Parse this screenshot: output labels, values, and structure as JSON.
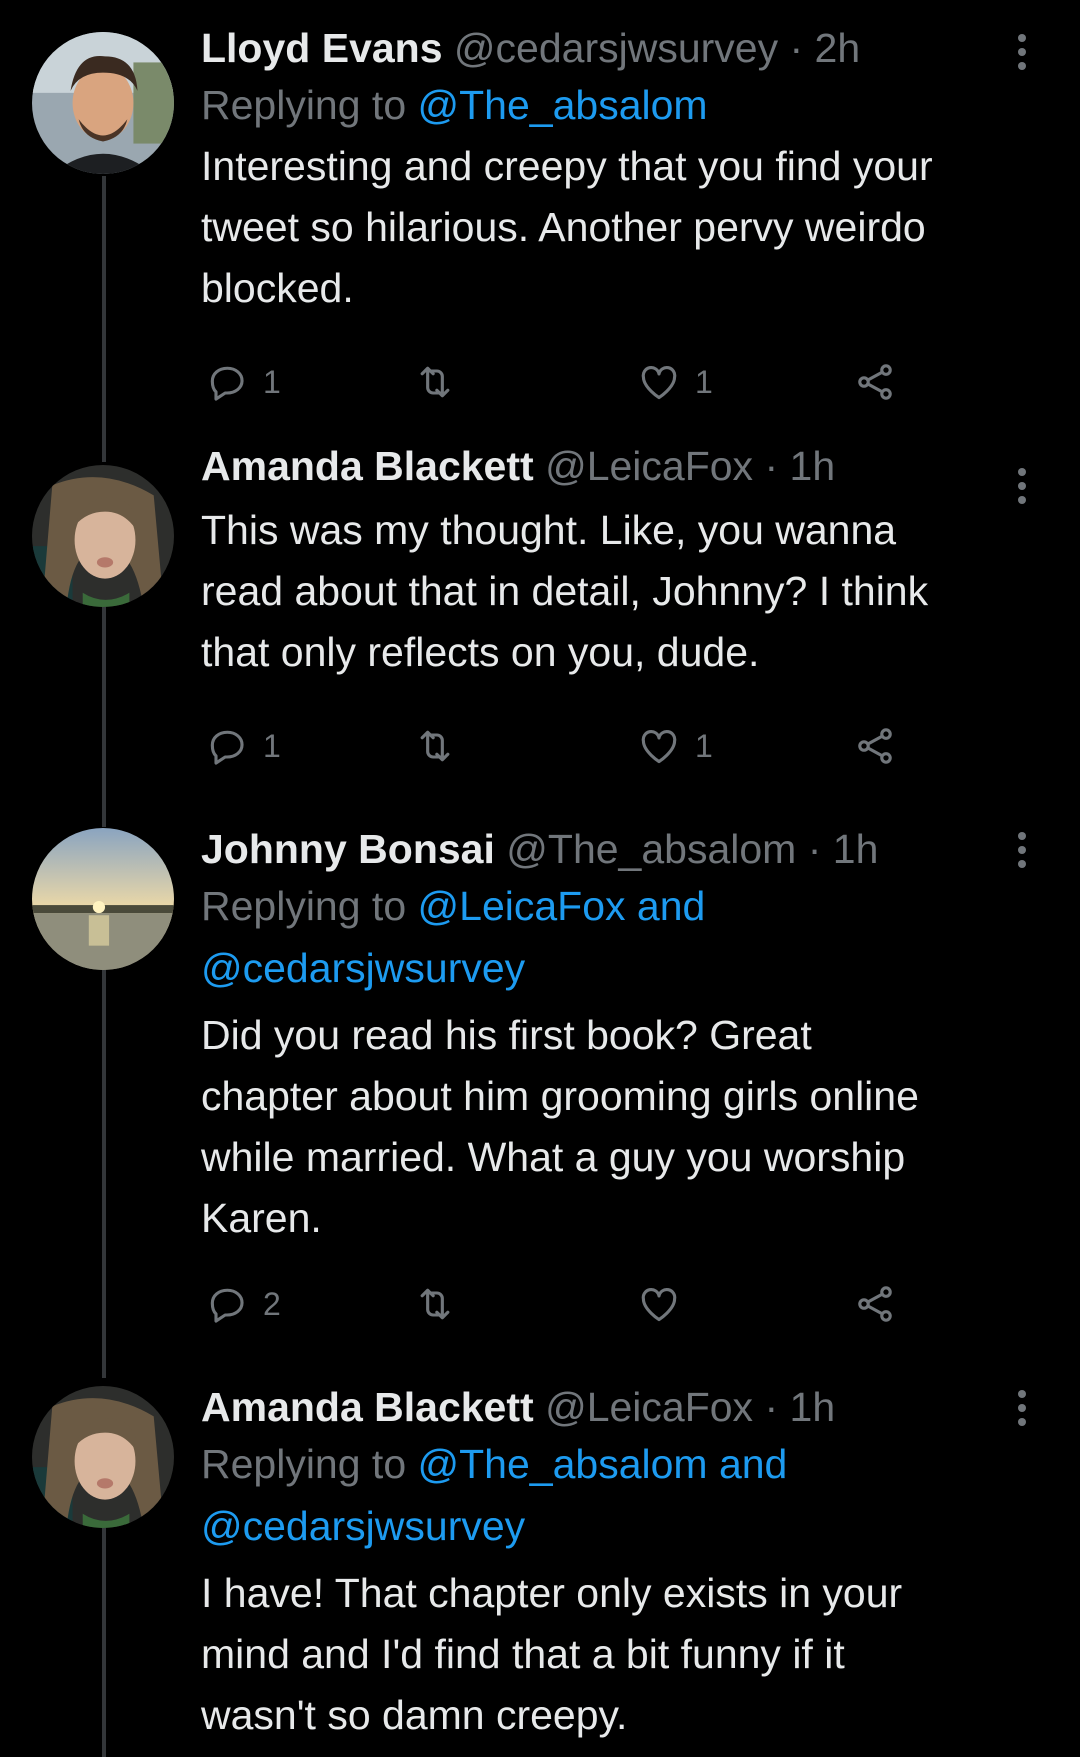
{
  "tweets": [
    {
      "name": "Lloyd Evans",
      "handle": "@cedarsjwsurvey",
      "time": "· 2h",
      "reply_prefix": "Replying to ",
      "reply_to_line1": "@The_absalom",
      "reply_to_line2": "",
      "text_lines": [
        "Interesting and creepy that you find your",
        "tweet so hilarious. Another pervy weirdo",
        "blocked."
      ],
      "reply_count": "1",
      "like_count": "1"
    },
    {
      "name": "Amanda Blackett",
      "handle": "@LeicaFox",
      "time": "· 1h",
      "reply_prefix": "",
      "reply_to_line1": "",
      "reply_to_line2": "",
      "text_lines": [
        "This was my thought. Like, you wanna",
        "read about that in detail, Johnny? I think",
        "that only reflects on you, dude."
      ],
      "reply_count": "1",
      "like_count": "1"
    },
    {
      "name": "Johnny Bonsai",
      "handle": "@The_absalom",
      "time": "· 1h",
      "reply_prefix": "Replying to ",
      "reply_to_line1": "@LeicaFox and",
      "reply_to_line2": "@cedarsjwsurvey",
      "text_lines": [
        "Did you read his first book?  Great",
        "chapter about him grooming girls online",
        "while married. What a guy you worship",
        "Karen."
      ],
      "reply_count": "2",
      "like_count": ""
    },
    {
      "name": "Amanda Blackett",
      "handle": "@LeicaFox",
      "time": "· 1h",
      "reply_prefix": "Replying to ",
      "reply_to_line1": "@The_absalom and",
      "reply_to_line2": "@cedarsjwsurvey",
      "text_lines": [
        "I have! That chapter only exists in your",
        "mind and I'd find that a bit funny if it",
        "wasn't so damn creepy."
      ],
      "reply_count": "",
      "like_count": ""
    }
  ],
  "icons": {
    "reply": "reply-icon",
    "retweet": "retweet-icon",
    "like": "heart-icon",
    "share": "share-icon",
    "more": "more-vertical-icon"
  },
  "colors": {
    "background": "#000000",
    "text": "#e7e9ea",
    "muted": "#71767b",
    "link": "#1d9bf0"
  }
}
